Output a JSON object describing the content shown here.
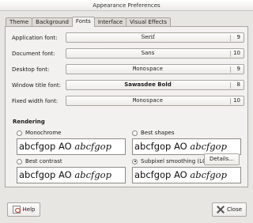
{
  "window": {
    "title": "Appearance Preferences"
  },
  "tabs": [
    {
      "label": "Theme"
    },
    {
      "label": "Background"
    },
    {
      "label": "Fonts"
    },
    {
      "label": "Interface"
    },
    {
      "label": "Visual Effects"
    }
  ],
  "active_tab": "Fonts",
  "fonts": [
    {
      "label": "Application font:",
      "font": "Serif",
      "size": "9"
    },
    {
      "label": "Document font:",
      "font": "Sans",
      "size": "10"
    },
    {
      "label": "Desktop font:",
      "font": "Monospace",
      "size": "9"
    },
    {
      "label": "Window title font:",
      "font": "Sawasdee Bold",
      "size": "8"
    },
    {
      "label": "Fixed width font:",
      "font": "Monospace",
      "size": "10"
    }
  ],
  "rendering": {
    "title": "Rendering",
    "options": [
      {
        "label": "Monochrome",
        "sample_regular": "abcfgop AO ",
        "sample_italic": "abcfgop",
        "checked": false
      },
      {
        "label": "Best shapes",
        "sample_regular": "abcfgop AO ",
        "sample_italic": "abcfgop",
        "checked": false
      },
      {
        "label": "Best contrast",
        "sample_regular": "abcfgop AO ",
        "sample_italic": "abcfgop",
        "checked": false
      },
      {
        "label": "Subpixel smoothing (LCDs)",
        "sample_regular": "abcfgop AO ",
        "sample_italic": "abcfgop",
        "checked": true
      }
    ]
  },
  "buttons": {
    "details": "Details...",
    "help": "Help",
    "close": "Close"
  }
}
